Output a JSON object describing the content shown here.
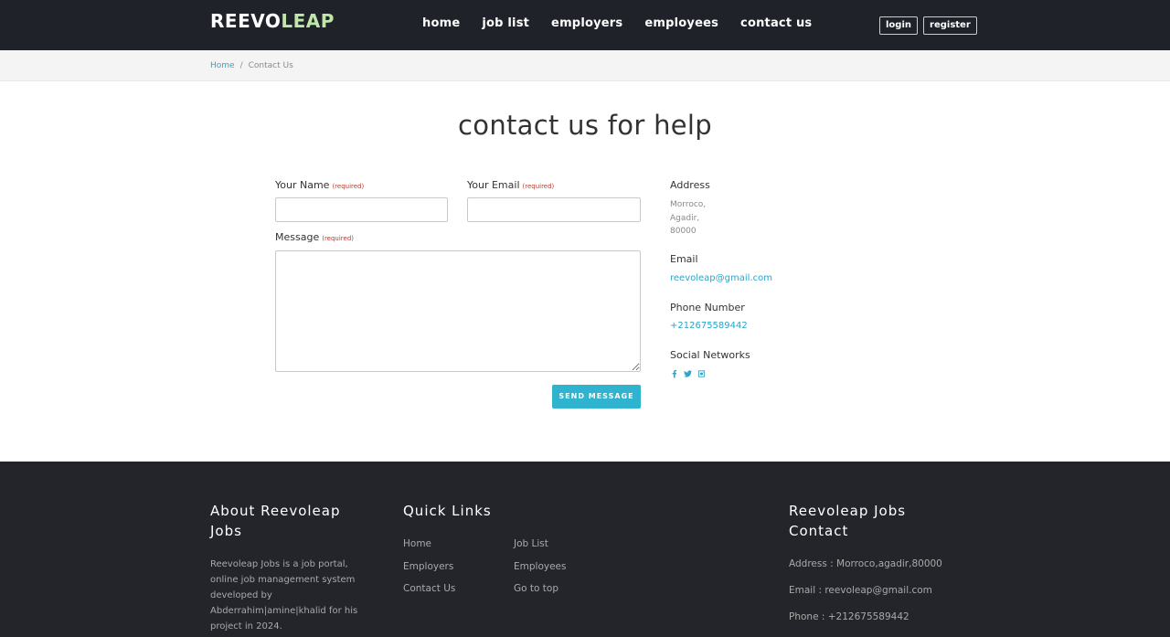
{
  "brand": {
    "logo_main": "REEVOLEAP",
    "logo_part1": "REEVO",
    "logo_part2": "LEAP"
  },
  "nav": {
    "items": [
      "home",
      "job list",
      "employers",
      "employees",
      "contact us"
    ]
  },
  "auth": {
    "login": "login",
    "register": "register"
  },
  "breadcrumb": {
    "home": "Home",
    "separator": "/",
    "current": "Contact Us"
  },
  "page": {
    "title": "contact us for help"
  },
  "form": {
    "name_label": "Your Name",
    "email_label": "Your Email",
    "message_label": "Message",
    "required": "(required)",
    "name_value": "",
    "email_value": "",
    "message_value": "",
    "send_label": "SEND MESSAGE"
  },
  "info": {
    "address_heading": "Address",
    "address_lines": [
      "Morroco,",
      "Agadir,",
      "80000"
    ],
    "email_heading": "Email",
    "email": "reevoleap@gmail.com",
    "phone_heading": "Phone Number",
    "phone": "+212675589442",
    "social_heading": "Social Networks",
    "social_icons": [
      "facebook-icon",
      "twitter-icon",
      "instagram-icon"
    ],
    "accent_color": "#2aa5c8"
  },
  "footer": {
    "about_heading": "About Reevoleap Jobs",
    "about_line1": "About Reevoleap",
    "about_line2": "Jobs",
    "about_text": [
      "Reevoleap Jobs is a job portal,",
      "online job management system",
      "developed by",
      "Abderrahim|amine|khalid for his",
      "project in 2024."
    ],
    "quick_links_heading": "Quick Links",
    "links_col1": [
      "Home",
      "Employers",
      "Contact Us"
    ],
    "links_col2": [
      "Job List",
      "Employees",
      "Go to top"
    ],
    "contact_heading_line1": "Reevoleap Jobs",
    "contact_heading_line2": "Contact",
    "address": "Address : Morroco,agadir,80000",
    "email": "Email : reevoleap@gmail.com",
    "phone": "Phone : +212675589442"
  }
}
